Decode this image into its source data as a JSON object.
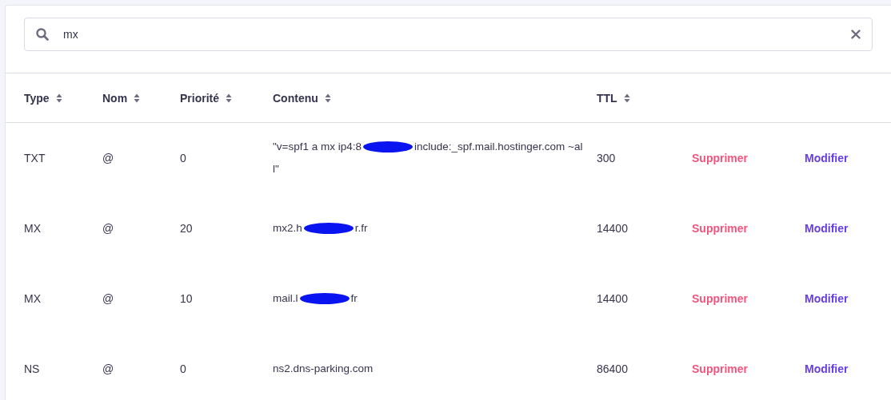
{
  "search": {
    "value": "mx"
  },
  "table": {
    "columns": [
      "Type",
      "Nom",
      "Priorité",
      "Contenu",
      "TTL"
    ],
    "rows": [
      {
        "type": "TXT",
        "name": "@",
        "priority": "0",
        "content": [
          {
            "kind": "text",
            "text": "\"v=spf1 a mx ip4:8"
          },
          {
            "kind": "redaction"
          },
          {
            "kind": "text",
            "text": "include:_spf.mail.hostinger.com ~all\""
          }
        ],
        "ttl": "300",
        "actions": [
          "Supprimer",
          "Modifier"
        ]
      },
      {
        "type": "MX",
        "name": "@",
        "priority": "20",
        "content": [
          {
            "kind": "text",
            "text": "mx2.h"
          },
          {
            "kind": "redaction"
          },
          {
            "kind": "text",
            "text": "r.fr"
          }
        ],
        "ttl": "14400",
        "actions": [
          "Supprimer",
          "Modifier"
        ]
      },
      {
        "type": "MX",
        "name": "@",
        "priority": "10",
        "content": [
          {
            "kind": "text",
            "text": "mail.l"
          },
          {
            "kind": "redaction"
          },
          {
            "kind": "text",
            "text": "fr"
          }
        ],
        "ttl": "14400",
        "actions": [
          "Supprimer",
          "Modifier"
        ]
      },
      {
        "type": "NS",
        "name": "@",
        "priority": "0",
        "content": [
          {
            "kind": "text",
            "text": "ns2.dns-parking.com"
          }
        ],
        "ttl": "86400",
        "actions": [
          "Supprimer",
          "Modifier"
        ]
      }
    ]
  }
}
